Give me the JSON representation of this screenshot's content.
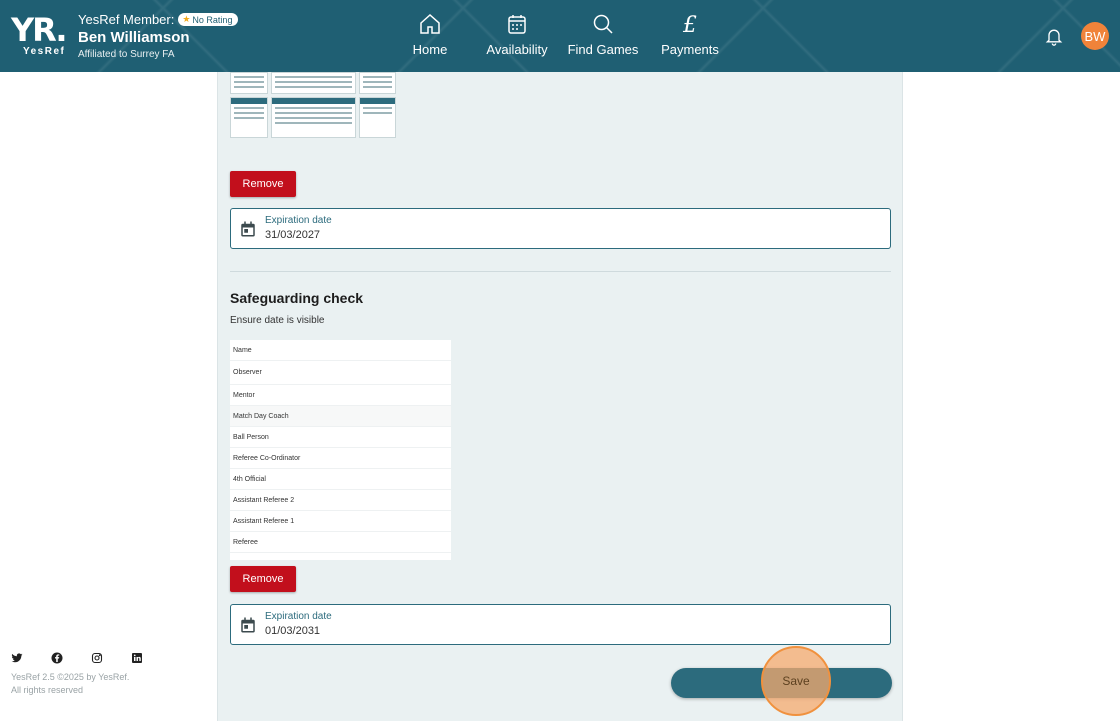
{
  "header": {
    "logo_text": "YR.",
    "logo_word": "YesRef",
    "member_label": "YesRef Member:",
    "rating_badge": "No Rating",
    "user_name": "Ben Williamson",
    "affiliation": "Affiliated to Surrey FA",
    "avatar_initials": "BW",
    "nav": [
      {
        "label": "Home",
        "icon": "home-icon"
      },
      {
        "label": "Availability",
        "icon": "calendar-icon"
      },
      {
        "label": "Find Games",
        "icon": "search-icon"
      },
      {
        "label": "Payments",
        "icon": "pound-icon"
      }
    ],
    "colors": {
      "header_bg": "#1f5f73",
      "avatar_bg": "#f0833a"
    }
  },
  "first_document": {
    "remove_label": "Remove",
    "expiration_label": "Expiration date",
    "expiration_value": "31/03/2027"
  },
  "safeguarding": {
    "title": "Safeguarding check",
    "hint": "Ensure date is visible",
    "document_rows": [
      "Name",
      "Observer",
      "Mentor",
      "Match Day Coach",
      "Ball Person",
      "Referee Co-Ordinator",
      "4th Official",
      "Assistant Referee 2",
      "Assistant Referee 1",
      "Referee"
    ],
    "remove_label": "Remove",
    "expiration_label": "Expiration date",
    "expiration_value": "01/03/2031"
  },
  "save_label": "Save",
  "footer": {
    "social": [
      "twitter-icon",
      "facebook-icon",
      "instagram-icon",
      "linkedin-icon"
    ],
    "version": "YesRef 2.5 ©2025 by YesRef.",
    "rights": "All rights reserved"
  },
  "colors": {
    "remove": "#c20f1c",
    "save": "#2c6b7d",
    "panel_bg": "#eaf1f2"
  }
}
